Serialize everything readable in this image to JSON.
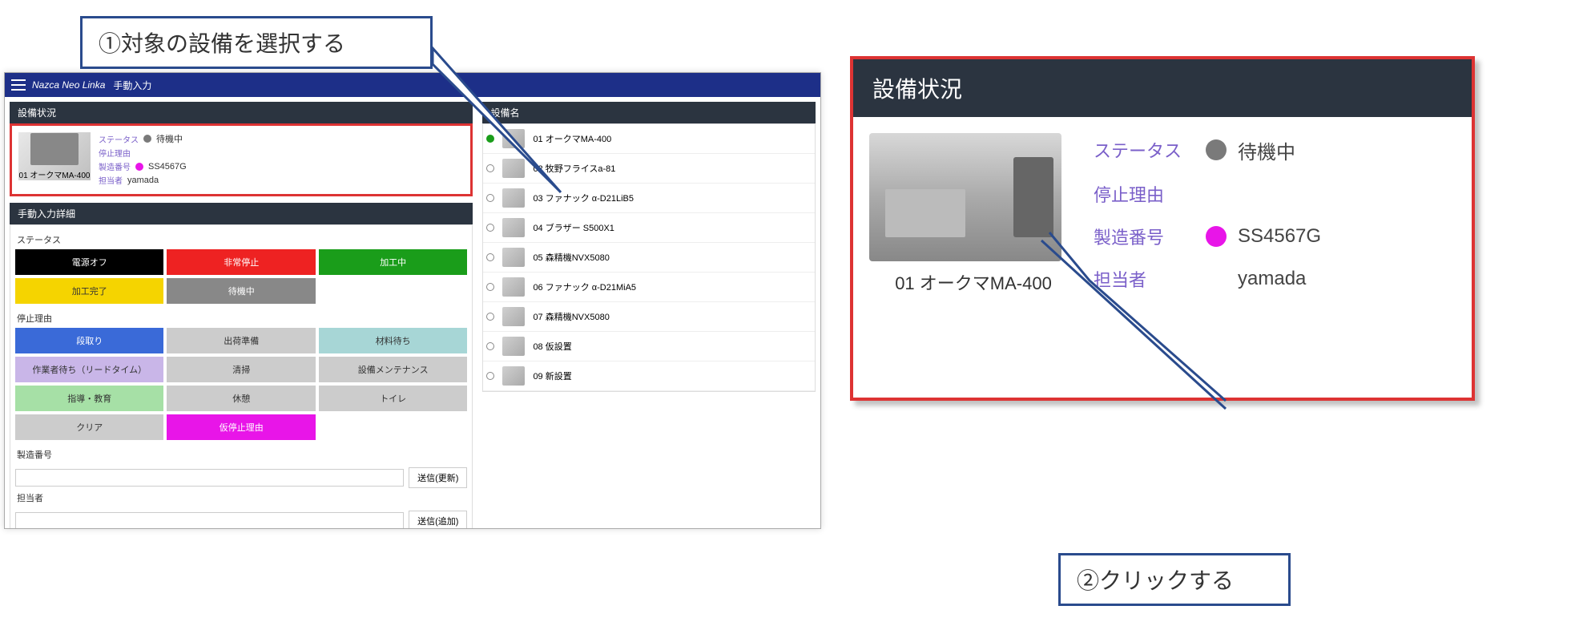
{
  "callouts": {
    "step1": "①対象の設備を選択する",
    "step2": "②クリックする"
  },
  "app": {
    "title": "Nazca Neo Linka",
    "subtitle": "手動入力"
  },
  "equipment_status": {
    "panel_title": "設備状況",
    "name": "01 オークマMA-400",
    "labels": {
      "status": "ステータス",
      "stop_reason": "停止理由",
      "serial": "製造番号",
      "operator": "担当者"
    },
    "values": {
      "status": "待機中",
      "stop_reason": "",
      "serial": "SS4567G",
      "operator": "yamada"
    },
    "colors": {
      "status_dot": "#7a7a7a",
      "serial_dot": "#e815e8"
    }
  },
  "manual_input": {
    "panel_title": "手動入力詳細",
    "status_label": "ステータス",
    "status_buttons": [
      {
        "label": "電源オフ",
        "cls": "black"
      },
      {
        "label": "非常停止",
        "cls": "red"
      },
      {
        "label": "加工中",
        "cls": "green"
      },
      {
        "label": "加工完了",
        "cls": "yellow"
      },
      {
        "label": "待機中",
        "cls": "gray"
      },
      {
        "label": "",
        "cls": "blank"
      }
    ],
    "stop_reason_label": "停止理由",
    "stop_reason_buttons": [
      {
        "label": "段取り",
        "cls": "blue"
      },
      {
        "label": "出荷準備",
        "cls": "ltgray"
      },
      {
        "label": "材料待ち",
        "cls": "teal"
      },
      {
        "label": "作業者待ち（リードタイム）",
        "cls": "lavender"
      },
      {
        "label": "清掃",
        "cls": "ltgray"
      },
      {
        "label": "設備メンテナンス",
        "cls": "ltgray"
      },
      {
        "label": "指導・教育",
        "cls": "ltgreen"
      },
      {
        "label": "休憩",
        "cls": "ltgray"
      },
      {
        "label": "トイレ",
        "cls": "ltgray"
      },
      {
        "label": "クリア",
        "cls": "ltgray"
      },
      {
        "label": "仮停止理由",
        "cls": "magenta"
      },
      {
        "label": "",
        "cls": "blank"
      }
    ],
    "serial_label": "製造番号",
    "operator_label": "担当者",
    "send_update": "送信(更新)",
    "send_new": "送信(追加)"
  },
  "equipment_list": {
    "panel_title": "設備名",
    "items": [
      {
        "label": "01 オークマMA-400",
        "selected": true
      },
      {
        "label": "02 牧野フライスa-81",
        "selected": false
      },
      {
        "label": "03 ファナック α-D21LiB5",
        "selected": false
      },
      {
        "label": "04 ブラザー S500X1",
        "selected": false
      },
      {
        "label": "05 森精機NVX5080",
        "selected": false
      },
      {
        "label": "06 ファナック α-D21MiA5",
        "selected": false
      },
      {
        "label": "07 森精機NVX5080",
        "selected": false
      },
      {
        "label": "08 仮設置",
        "selected": false
      },
      {
        "label": "09 新設置",
        "selected": false
      }
    ]
  },
  "enlarged": {
    "panel_title": "設備状況",
    "name": "01 オークマMA-400",
    "rows": {
      "status_label": "ステータス",
      "status_value": "待機中",
      "stop_reason_label": "停止理由",
      "serial_label": "製造番号",
      "serial_value": "SS4567G",
      "operator_label": "担当者",
      "operator_value": "yamada"
    }
  }
}
